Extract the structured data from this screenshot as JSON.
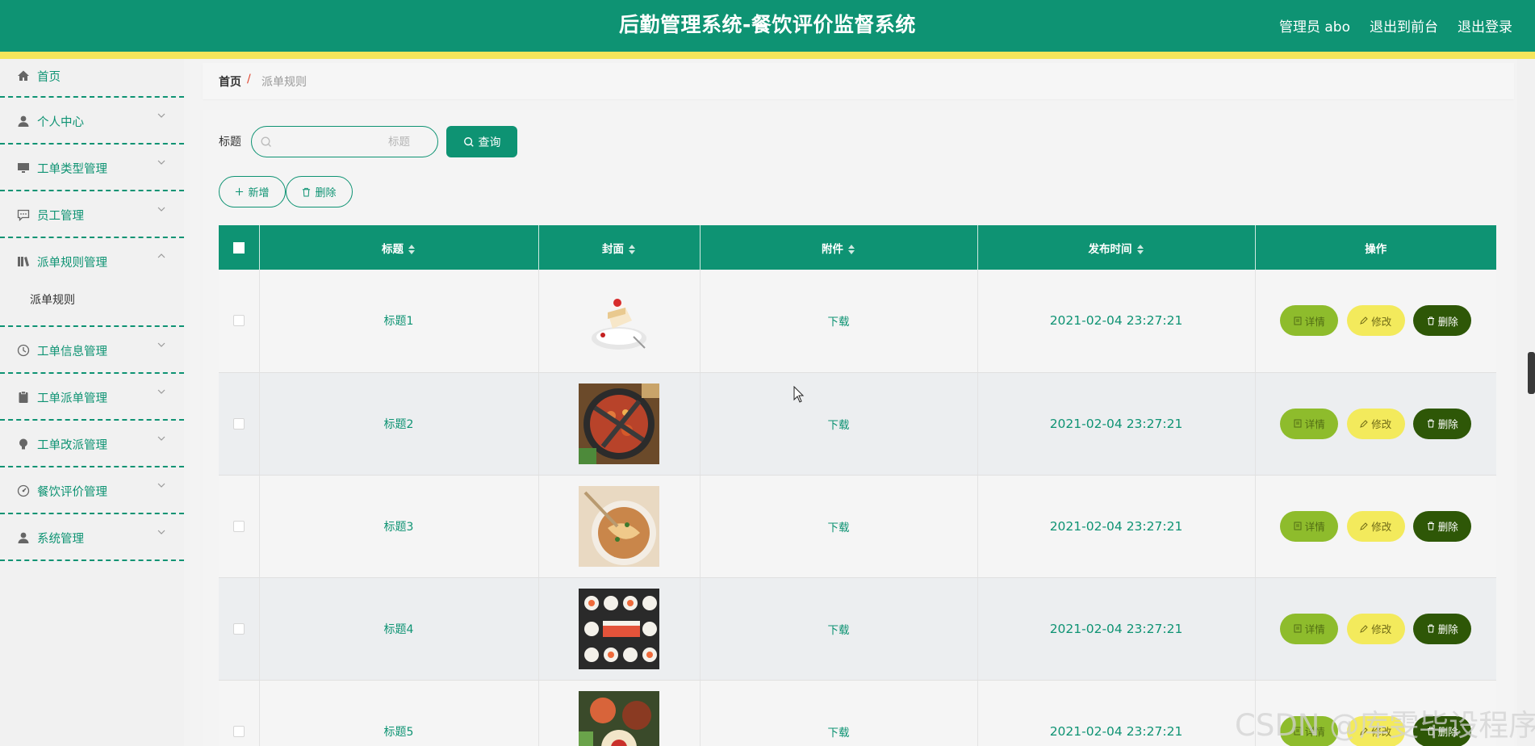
{
  "header": {
    "title": "后勤管理系统-餐饮评价监督系统",
    "admin_label": "管理员 abo",
    "to_front_label": "退出到前台",
    "logout_label": "退出登录"
  },
  "sidebar": {
    "items": [
      {
        "label": "首页",
        "icon": "home-icon"
      },
      {
        "label": "个人中心",
        "icon": "user-icon"
      },
      {
        "label": "工单类型管理",
        "icon": "monitor-icon"
      },
      {
        "label": "员工管理",
        "icon": "chat-icon"
      },
      {
        "label": "派单规则管理",
        "icon": "book-icon",
        "expanded": true
      },
      {
        "label": "工单信息管理",
        "icon": "clock-icon"
      },
      {
        "label": "工单派单管理",
        "icon": "clipboard-icon"
      },
      {
        "label": "工单改派管理",
        "icon": "bulb-icon"
      },
      {
        "label": "餐饮评价管理",
        "icon": "gauge-icon"
      },
      {
        "label": "系统管理",
        "icon": "user-icon"
      }
    ],
    "subitem_label": "派单规则"
  },
  "breadcrumb": {
    "home": "首页",
    "separator": "/",
    "current": "派单规则"
  },
  "search": {
    "label": "标题",
    "placeholder": "标题",
    "query_label": "查询"
  },
  "actions": {
    "add_label": "新增",
    "delete_label": "删除"
  },
  "table": {
    "columns": [
      "标题",
      "封面",
      "附件",
      "发布时间",
      "操作"
    ],
    "rows": [
      {
        "title": "标题1",
        "cover": "cake",
        "attachment": "下载",
        "time": "2021-02-04 23:27:21"
      },
      {
        "title": "标题2",
        "cover": "hotpot",
        "attachment": "下载",
        "time": "2021-02-04 23:27:21"
      },
      {
        "title": "标题3",
        "cover": "noodles",
        "attachment": "下载",
        "time": "2021-02-04 23:27:21"
      },
      {
        "title": "标题4",
        "cover": "sushi",
        "attachment": "下载",
        "time": "2021-02-04 23:27:21"
      },
      {
        "title": "标题5",
        "cover": "platter",
        "attachment": "下载",
        "time": "2021-02-04 23:27:21"
      }
    ],
    "row_actions": {
      "detail": "详情",
      "edit": "修改",
      "delete": "删除"
    }
  },
  "watermark": "CSDN @库雯毕设程序",
  "colors": {
    "primary": "#0e9373",
    "accent_stripe": "#f4e55b",
    "detail_button": "#8ebc2c",
    "edit_button": "#f3ea5c",
    "delete_button": "#2e5707"
  }
}
